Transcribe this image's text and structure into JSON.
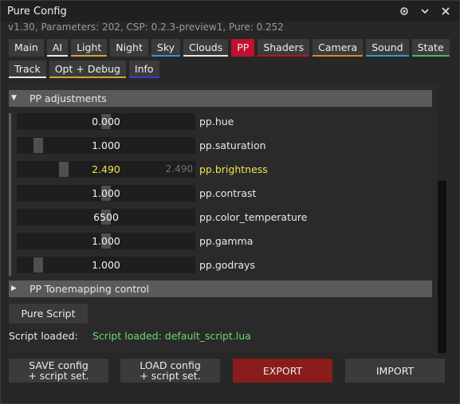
{
  "window": {
    "title": "Pure Config",
    "version_line": "v1.30, Parameters: 202, CSP: 0.2.3-preview1, Pure: 0.252"
  },
  "title_icons": [
    "gear-icon",
    "chevron-down-icon",
    "close-icon"
  ],
  "tabs_row1": [
    {
      "label": "Main",
      "underline": ""
    },
    {
      "label": "AI",
      "underline": "#e6e6e6"
    },
    {
      "label": "Light",
      "underline": "#d4a43a"
    },
    {
      "label": "Night",
      "underline": ""
    },
    {
      "label": "Sky",
      "underline": "#3a8fd4"
    },
    {
      "label": "Clouds",
      "underline": "#e6e6e6"
    },
    {
      "label": "PP",
      "underline": "",
      "active": true
    },
    {
      "label": "Shaders",
      "underline": "#c0102c"
    },
    {
      "label": "Camera",
      "underline": "#d48a2a"
    },
    {
      "label": "Sound",
      "underline": "#2aa0c0"
    },
    {
      "label": "State",
      "underline": "#3ac05a"
    }
  ],
  "tabs_row2": [
    {
      "label": "Track",
      "underline": "#e6e6e6"
    },
    {
      "label": "Opt + Debug",
      "underline": "#d4a43a"
    },
    {
      "label": "Info",
      "underline": "#3a3ad4"
    }
  ],
  "pp_section": {
    "title": "PP adjustments",
    "sliders": [
      {
        "value": "0.000",
        "param": "pp.hue",
        "level": 0.5
      },
      {
        "value": "1.000",
        "param": "pp.saturation",
        "level": 0.1
      },
      {
        "value": "2.490",
        "param": "pp.brightness",
        "level": 0.25,
        "highlight": true,
        "hint": "2.490"
      },
      {
        "value": "1.000",
        "param": "pp.contrast",
        "level": 0.5
      },
      {
        "value": "6500",
        "param": "pp.color_temperature",
        "level": 0.5
      },
      {
        "value": "1.000",
        "param": "pp.gamma",
        "level": 0.5
      },
      {
        "value": "1.000",
        "param": "pp.godrays",
        "level": 0.1
      }
    ]
  },
  "tonemap_section": {
    "title": "PP Tonemapping control"
  },
  "script": {
    "button_label": "Pure Script",
    "loaded_label": "Script loaded:",
    "loaded_status": "Script loaded: default_script.lua"
  },
  "bottom_buttons": [
    {
      "line1": "SAVE config",
      "line2": "+ script set."
    },
    {
      "line1": "LOAD config",
      "line2": "+ script set."
    },
    {
      "line1": "EXPORT",
      "line2": ""
    },
    {
      "line1": "IMPORT",
      "line2": ""
    }
  ],
  "colors": {
    "accent_active": "#c0102c",
    "highlight_text": "#f1e54a",
    "status_green": "#6cdc6c",
    "export_button": "#8a1c1c"
  }
}
